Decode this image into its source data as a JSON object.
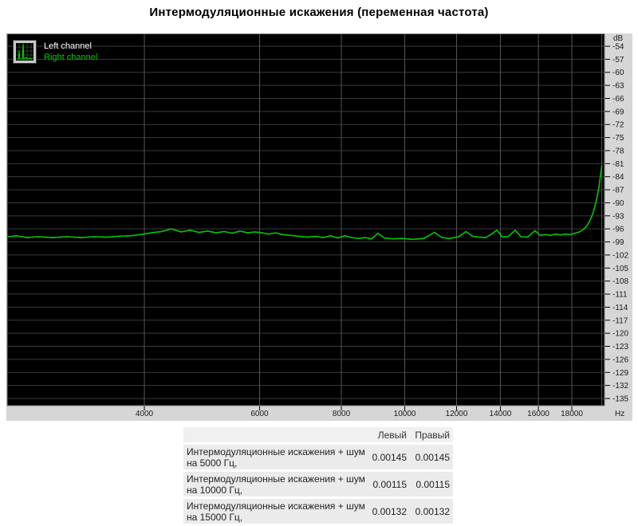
{
  "title": "Интермодуляционные искажения (переменная частота)",
  "chart": {
    "legend": [
      {
        "label": "Left channel",
        "color": "#ffffff"
      },
      {
        "label": "Right channel",
        "color": "#00cc00"
      }
    ],
    "y_axis_unit": "dB",
    "x_axis_unit": "Hz"
  },
  "chart_data": {
    "type": "line",
    "title": "Интермодуляционные искажения (переменная частота)",
    "x_unit": "Hz",
    "y_unit": "dB",
    "x_scale": "log",
    "grid": true,
    "legend_position": "top-left",
    "background": "#000000",
    "x_range": [
      2475,
      20100
    ],
    "y_range": [
      -136.6,
      -51.1
    ],
    "x_tick_labels": [
      4000,
      6000,
      8000,
      10000,
      12000,
      14000,
      16000,
      18000
    ],
    "x_gridlines": [
      4000,
      6000,
      8000,
      10000,
      12000,
      14000,
      16000,
      18000,
      20000
    ],
    "y_ticks": [
      -54,
      -57,
      -60,
      -63,
      -66,
      -69,
      -72,
      -75,
      -78,
      -81,
      -84,
      -87,
      -90,
      -93,
      -96,
      -99,
      -102,
      -105,
      -108,
      -111,
      -114,
      -117,
      -120,
      -123,
      -126,
      -129,
      -132,
      -135
    ],
    "series": [
      {
        "name": "Left channel",
        "color": "#ffffff"
      },
      {
        "name": "Right channel",
        "color": "#00c400"
      }
    ],
    "points": [
      [
        2475,
        -97.8
      ],
      [
        2550,
        -97.6
      ],
      [
        2650,
        -98.0
      ],
      [
        2750,
        -97.8
      ],
      [
        2900,
        -98.0
      ],
      [
        3050,
        -97.8
      ],
      [
        3200,
        -98.0
      ],
      [
        3350,
        -97.8
      ],
      [
        3500,
        -97.9
      ],
      [
        3650,
        -97.7
      ],
      [
        3800,
        -97.6
      ],
      [
        3950,
        -97.3
      ],
      [
        4100,
        -96.9
      ],
      [
        4250,
        -96.6
      ],
      [
        4400,
        -96.0
      ],
      [
        4550,
        -96.7
      ],
      [
        4700,
        -96.3
      ],
      [
        4850,
        -96.8
      ],
      [
        5000,
        -96.5
      ],
      [
        5150,
        -96.9
      ],
      [
        5300,
        -96.6
      ],
      [
        5450,
        -97.0
      ],
      [
        5600,
        -96.5
      ],
      [
        5750,
        -96.9
      ],
      [
        5900,
        -96.7
      ],
      [
        6050,
        -96.9
      ],
      [
        6200,
        -97.2
      ],
      [
        6350,
        -96.9
      ],
      [
        6500,
        -97.3
      ],
      [
        6700,
        -97.5
      ],
      [
        6900,
        -97.7
      ],
      [
        7100,
        -97.9
      ],
      [
        7300,
        -97.7
      ],
      [
        7500,
        -98.0
      ],
      [
        7700,
        -97.6
      ],
      [
        7900,
        -98.1
      ],
      [
        8100,
        -97.6
      ],
      [
        8300,
        -98.0
      ],
      [
        8500,
        -98.2
      ],
      [
        8700,
        -98.0
      ],
      [
        8900,
        -98.3
      ],
      [
        9100,
        -97.0
      ],
      [
        9300,
        -98.1
      ],
      [
        9600,
        -98.3
      ],
      [
        9900,
        -98.2
      ],
      [
        10300,
        -98.4
      ],
      [
        10700,
        -98.2
      ],
      [
        11100,
        -96.8
      ],
      [
        11400,
        -98.0
      ],
      [
        11700,
        -98.2
      ],
      [
        12100,
        -97.8
      ],
      [
        12400,
        -96.6
      ],
      [
        12700,
        -97.7
      ],
      [
        13000,
        -97.9
      ],
      [
        13300,
        -98.0
      ],
      [
        13600,
        -97.1
      ],
      [
        13830,
        -96.3
      ],
      [
        14100,
        -97.9
      ],
      [
        14400,
        -97.7
      ],
      [
        14750,
        -96.3
      ],
      [
        15050,
        -97.8
      ],
      [
        15400,
        -97.9
      ],
      [
        15820,
        -96.4
      ],
      [
        16100,
        -97.5
      ],
      [
        16400,
        -97.3
      ],
      [
        16700,
        -97.5
      ],
      [
        17000,
        -97.2
      ],
      [
        17300,
        -97.4
      ],
      [
        17600,
        -97.2
      ],
      [
        17900,
        -97.3
      ],
      [
        18200,
        -97.0
      ],
      [
        18500,
        -96.7
      ],
      [
        18800,
        -96.0
      ],
      [
        19000,
        -95.2
      ],
      [
        19200,
        -94.0
      ],
      [
        19400,
        -92.3
      ],
      [
        19600,
        -89.8
      ],
      [
        19800,
        -86.5
      ],
      [
        20000,
        -81.5
      ]
    ]
  },
  "table": {
    "columns": [
      "Левый",
      "Правый"
    ],
    "rows": [
      {
        "label": "Интермодуляционные искажения + шум на 5000 Гц,",
        "left": "0.00145",
        "right": "0.00145"
      },
      {
        "label": "Интермодуляционные искажения + шум на 10000 Гц,",
        "left": "0.00115",
        "right": "0.00115"
      },
      {
        "label": "Интермодуляционные искажения + шум на 15000 Гц,",
        "left": "0.00132",
        "right": "0.00132"
      }
    ]
  },
  "colors": {
    "accent_green": "#00c400",
    "chart_bg": "#000000",
    "panel_gray": "#d6d6d6",
    "grid_horizontal": "#3a3a3a",
    "grid_vertical": "#565656",
    "axis_text": "#1a1a1a"
  }
}
